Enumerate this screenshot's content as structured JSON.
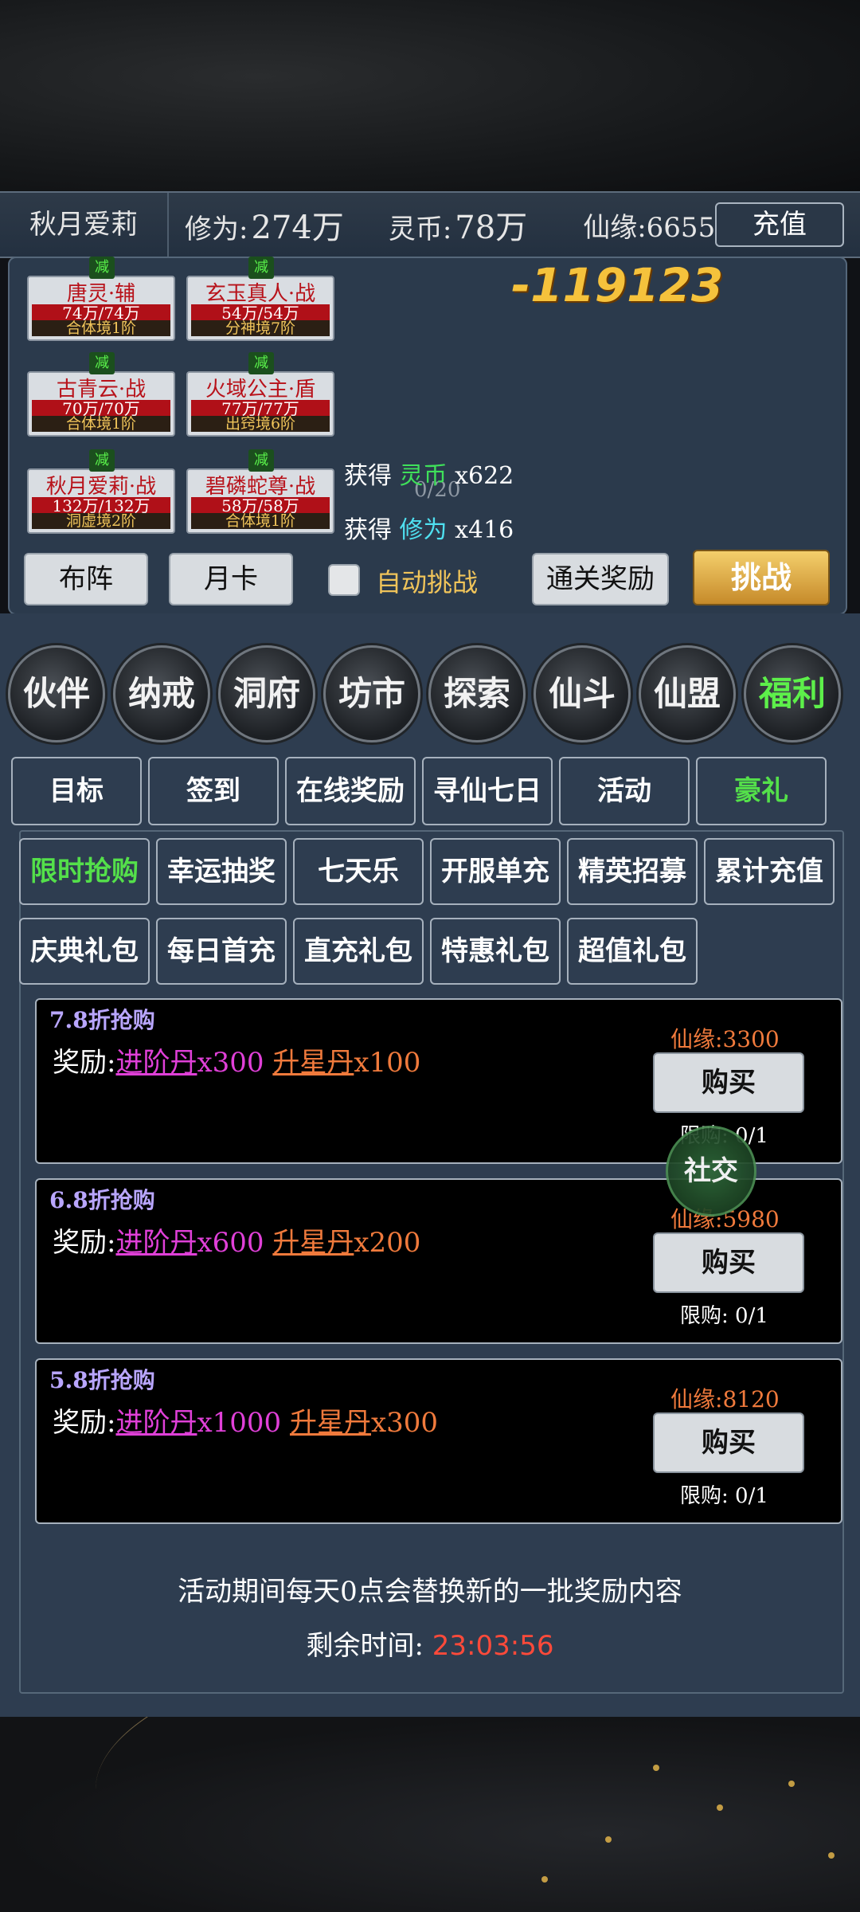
{
  "status": {
    "player_name": "秋月爱莉",
    "cultivation_label": "修为:",
    "cultivation_value": "274万",
    "spirit_coin_label": "灵币:",
    "spirit_coin_value": "78万",
    "fate_label": "仙缘:",
    "fate_value": "6655",
    "recharge_label": "充值"
  },
  "battle": {
    "damage": "-119123",
    "reduce_tag": "减",
    "units": [
      {
        "name": "唐灵·辅",
        "hp": "74万/74万",
        "level": "合体境1阶"
      },
      {
        "name": "玄玉真人·战",
        "hp": "54万/54万",
        "level": "分神境7阶"
      },
      {
        "name": "古青云·战",
        "hp": "70万/70万",
        "level": "合体境1阶"
      },
      {
        "name": "火域公主·盾",
        "hp": "77万/77万",
        "level": "出窍境6阶"
      },
      {
        "name": "秋月爱莉·战",
        "hp": "132万/132万",
        "level": "洞虚境2阶"
      },
      {
        "name": "碧磷蛇尊·战",
        "hp": "58万/58万",
        "level": "合体境1阶"
      }
    ],
    "progress_text": "0/20",
    "loot": [
      {
        "prefix": "获得 ",
        "resource": "灵币",
        "amount": " x622"
      },
      {
        "prefix": "获得 ",
        "resource": "修为",
        "amount": " x416"
      }
    ],
    "buttons": {
      "formation": "布阵",
      "monthly_card": "月卡",
      "auto_challenge": "自动挑战",
      "clear_reward": "通关奖励",
      "challenge": "挑战"
    }
  },
  "main_nav": {
    "items": [
      "伙伴",
      "纳戒",
      "洞府",
      "坊市",
      "探索",
      "仙斗",
      "仙盟",
      "福利"
    ],
    "active": "福利"
  },
  "welfare_tabs": {
    "items": [
      "目标",
      "签到",
      "在线奖励",
      "寻仙七日",
      "活动",
      "豪礼"
    ],
    "active": "豪礼"
  },
  "gift_tabs": {
    "row1": [
      "限时抢购",
      "幸运抽奖",
      "七天乐",
      "开服单充",
      "精英招募",
      "累计充值"
    ],
    "row2": [
      "庆典礼包",
      "每日首充",
      "直充礼包",
      "特惠礼包",
      "超值礼包"
    ],
    "active": "限时抢购"
  },
  "offers": [
    {
      "discount": "7.8折抢购",
      "reward_label": "奖励:",
      "item1": "进阶丹",
      "qty1": "x300 ",
      "item2": "升星丹",
      "qty2": "x100",
      "price_label": "仙缘:",
      "price": "3300",
      "buy": "购买",
      "limit_label": "限购: ",
      "limit": "0/1"
    },
    {
      "discount": "6.8折抢购",
      "reward_label": "奖励:",
      "item1": "进阶丹",
      "qty1": "x600 ",
      "item2": "升星丹",
      "qty2": "x200",
      "price_label": "仙缘:",
      "price": "5980",
      "buy": "购买",
      "limit_label": "限购: ",
      "limit": "0/1"
    },
    {
      "discount": "5.8折抢购",
      "reward_label": "奖励:",
      "item1": "进阶丹",
      "qty1": "x1000 ",
      "item2": "升星丹",
      "qty2": "x300",
      "price_label": "仙缘:",
      "price": "8120",
      "buy": "购买",
      "limit_label": "限购: ",
      "limit": "0/1"
    }
  ],
  "social_button": "社交",
  "notice": "活动期间每天0点会替换新的一批奖励内容",
  "remaining_label": "剩余时间: ",
  "remaining_time": "23:03:56"
}
